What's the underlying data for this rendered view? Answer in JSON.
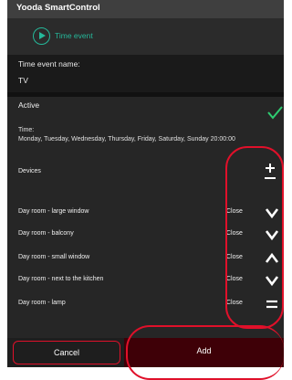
{
  "app": {
    "title": "Yooda SmartControl"
  },
  "header": {
    "label": "Time event",
    "icon": "play-circle-icon",
    "accent_color": "#25b89a"
  },
  "event": {
    "name_label": "Time event name:",
    "name_value": "TV",
    "active_label": "Active",
    "active_icon": "check-icon",
    "time_label": "Time:",
    "time_value": "Monday, Tuesday, Wednesday, Thursday, Friday, Saturday, Sunday 20:00:00"
  },
  "devices": {
    "label": "Devices",
    "toggle_icon": "plus-minus-icon",
    "items": [
      {
        "name": "Day room - large window",
        "state": "Close",
        "icon": "chevron-down-icon"
      },
      {
        "name": "Day room - balcony",
        "state": "Close",
        "icon": "chevron-down-icon"
      },
      {
        "name": "Day room - small window",
        "state": "Close",
        "icon": "chevron-up-icon"
      },
      {
        "name": "Day room - next to the kitchen",
        "state": "Close",
        "icon": "chevron-down-icon"
      },
      {
        "name": "Day room - lamp",
        "state": "Close",
        "icon": "equals-icon"
      }
    ]
  },
  "footer": {
    "cancel_label": "Cancel",
    "add_label": "Add"
  },
  "colors": {
    "highlight": "#e0102a",
    "add_button": "#3e0007",
    "check": "#2ecc71"
  }
}
